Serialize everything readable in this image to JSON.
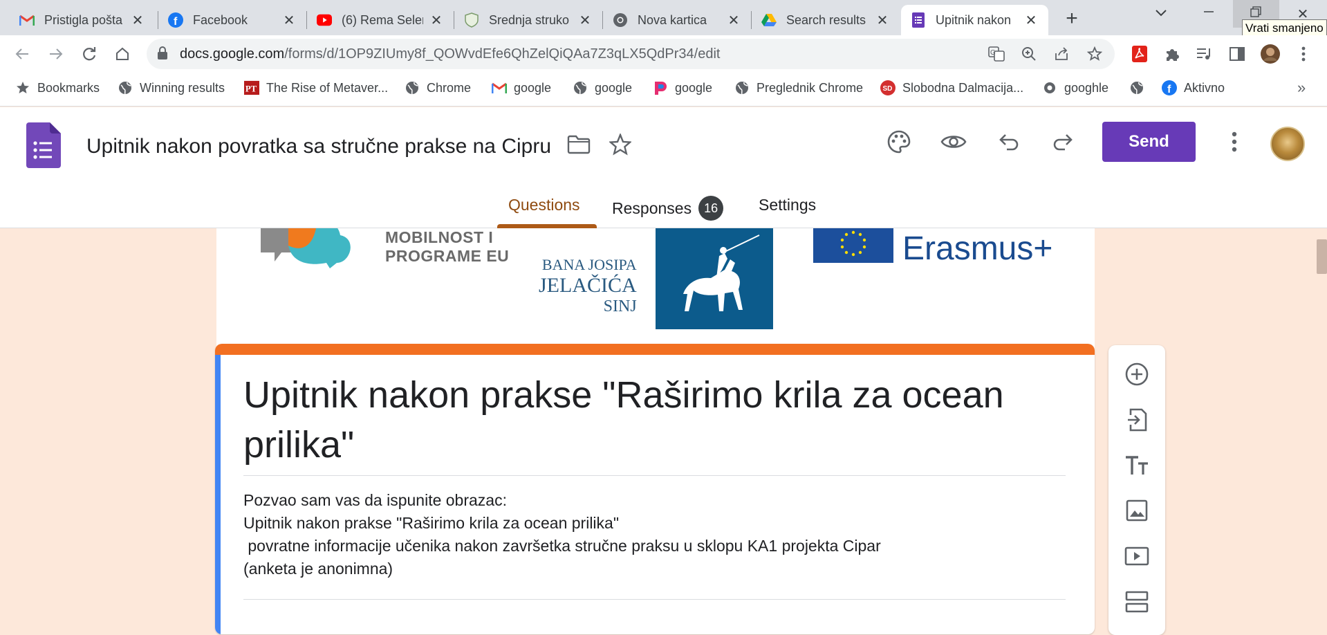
{
  "browser": {
    "tabs": [
      {
        "title": "Pristigla pošta",
        "icon": "gmail-icon"
      },
      {
        "title": "Facebook",
        "icon": "facebook-icon"
      },
      {
        "title": "(6) Rema Selen",
        "icon": "youtube-icon"
      },
      {
        "title": "Srednja struko",
        "icon": "shield-icon"
      },
      {
        "title": "Nova kartica",
        "icon": "chrome-icon"
      },
      {
        "title": "Search results",
        "icon": "google-drive-icon"
      },
      {
        "title": "Upitnik nakon",
        "icon": "google-forms-icon"
      }
    ],
    "active_tab_index": 6,
    "tooltip": "Vrati smanjeno",
    "url_host": "docs.google.com",
    "url_path": "/forms/d/1OP9ZIUmy8f_QOWvdEfe6QhZelQiQAa7Z3qLX5QdPr34/edit",
    "bookmarks": [
      {
        "label": "Bookmarks",
        "icon": "star-icon"
      },
      {
        "label": "Winning results",
        "icon": "globe-icon"
      },
      {
        "label": "The Rise of Metaver...",
        "icon": "pt-icon"
      },
      {
        "label": "Chrome",
        "icon": "globe-icon"
      },
      {
        "label": "google",
        "icon": "gmail-icon"
      },
      {
        "label": "google",
        "icon": "globe-icon"
      },
      {
        "label": "google",
        "icon": "p-icon"
      },
      {
        "label": "Preglednik Chrome",
        "icon": "globe-icon"
      },
      {
        "label": "Slobodna Dalmacija...",
        "icon": "sd-icon"
      },
      {
        "label": "googhle",
        "icon": "circle-icon"
      },
      {
        "label": "",
        "icon": "globe-icon"
      },
      {
        "label": "Aktivno",
        "icon": "facebook-icon"
      }
    ]
  },
  "forms": {
    "doc_title": "Upitnik nakon povratka sa stručne prakse na Cipru",
    "send_label": "Send",
    "tabs": {
      "questions": "Questions",
      "responses": "Responses",
      "responses_count": "16",
      "settings": "Settings"
    },
    "accent_color": "#673ab7",
    "theme_color": "#f26f21",
    "banner": {
      "mobility_text_1": "MOBILNOST I",
      "mobility_text_2": "PROGRAME EU",
      "school_line_1": "BANA JOSIPA",
      "school_line_2": "JELAČIĆA",
      "school_line_3": "SINJ",
      "erasmus": "Erasmus+"
    },
    "form_title": "Upitnik nakon prakse \"Raširimo krila za ocean prilika\"",
    "form_description": "Pozvao sam vas da ispunite obrazac:\nUpitnik nakon prakse \"Raširimo krila za ocean prilika\"\n povratne informacije učenika nakon završetka stručne praksu u sklopu KA1 projekta Cipar\n(anketa je anonimna)"
  }
}
